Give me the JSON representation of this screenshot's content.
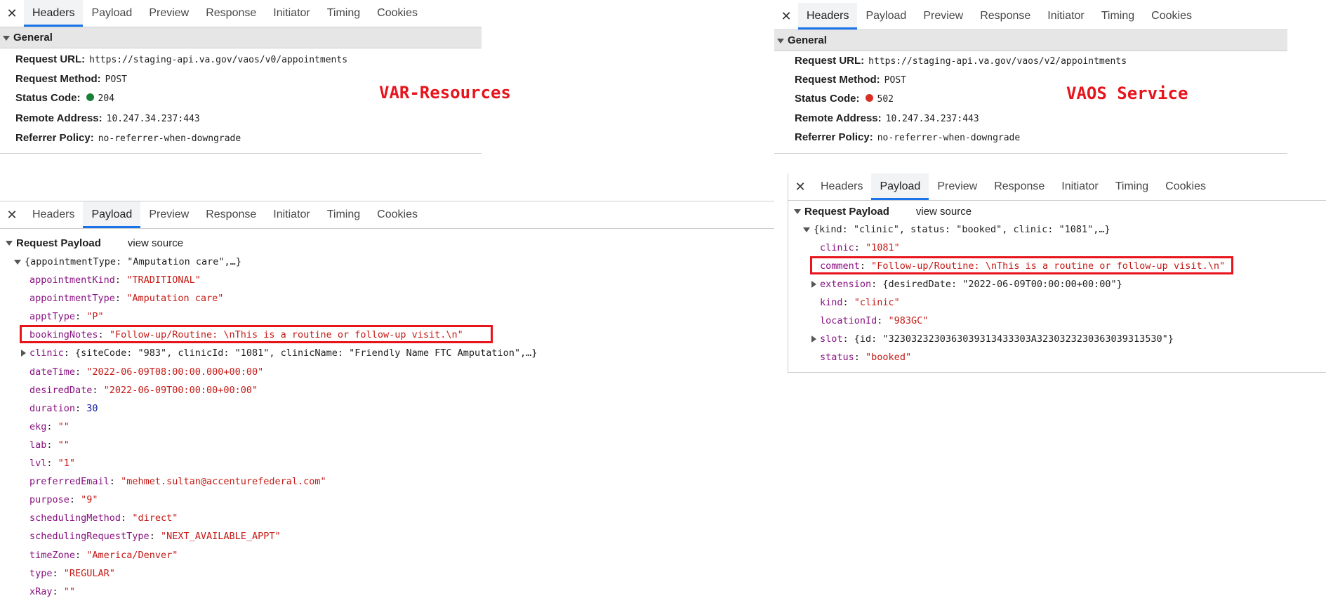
{
  "tabs": [
    "Headers",
    "Payload",
    "Preview",
    "Response",
    "Initiator",
    "Timing",
    "Cookies"
  ],
  "close_glyph": "✕",
  "left_headers": {
    "section": "General",
    "request_url_label": "Request URL:",
    "request_url": "https://staging-api.va.gov/vaos/v0/appointments",
    "request_method_label": "Request Method:",
    "request_method": "POST",
    "status_code_label": "Status Code:",
    "status_code": "204",
    "status_color": "#188038",
    "remote_address_label": "Remote Address:",
    "remote_address": "10.247.34.237:443",
    "referrer_policy_label": "Referrer Policy:",
    "referrer_policy": "no-referrer-when-downgrade",
    "annotation": "VAR-Resources"
  },
  "right_headers": {
    "section": "General",
    "request_url_label": "Request URL:",
    "request_url": "https://staging-api.va.gov/vaos/v2/appointments",
    "request_method_label": "Request Method:",
    "request_method": "POST",
    "status_code_label": "Status Code:",
    "status_code": "502",
    "status_color": "#d93025",
    "remote_address_label": "Remote Address:",
    "remote_address": "10.247.34.237:443",
    "referrer_policy_label": "Referrer Policy:",
    "referrer_policy": "no-referrer-when-downgrade",
    "annotation": "VAOS Service"
  },
  "left_payload": {
    "title": "Request Payload",
    "view_source": "view source",
    "summary": "{appointmentType: \"Amputation care\",…}",
    "fields": [
      {
        "key": "appointmentKind",
        "val": "\"TRADITIONAL\"",
        "type": "str"
      },
      {
        "key": "appointmentType",
        "val": "\"Amputation care\"",
        "type": "str"
      },
      {
        "key": "apptType",
        "val": "\"P\"",
        "type": "str"
      },
      {
        "key": "bookingNotes",
        "val": "\"Follow-up/Routine: \\nThis is a routine or follow-up visit.\\n\"",
        "type": "str",
        "highlight": true
      },
      {
        "key": "clinic",
        "val": "{siteCode: \"983\", clinicId: \"1081\", clinicName: \"Friendly Name FTC Amputation\",…}",
        "type": "obj",
        "expandable": true
      },
      {
        "key": "dateTime",
        "val": "\"2022-06-09T08:00:00.000+00:00\"",
        "type": "str"
      },
      {
        "key": "desiredDate",
        "val": "\"2022-06-09T00:00:00+00:00\"",
        "type": "str"
      },
      {
        "key": "duration",
        "val": "30",
        "type": "num"
      },
      {
        "key": "ekg",
        "val": "\"\"",
        "type": "str"
      },
      {
        "key": "lab",
        "val": "\"\"",
        "type": "str"
      },
      {
        "key": "lvl",
        "val": "\"1\"",
        "type": "str"
      },
      {
        "key": "preferredEmail",
        "val": "\"mehmet.sultan@accenturefederal.com\"",
        "type": "str"
      },
      {
        "key": "purpose",
        "val": "\"9\"",
        "type": "str"
      },
      {
        "key": "schedulingMethod",
        "val": "\"direct\"",
        "type": "str"
      },
      {
        "key": "schedulingRequestType",
        "val": "\"NEXT_AVAILABLE_APPT\"",
        "type": "str"
      },
      {
        "key": "timeZone",
        "val": "\"America/Denver\"",
        "type": "str"
      },
      {
        "key": "type",
        "val": "\"REGULAR\"",
        "type": "str"
      },
      {
        "key": "xRay",
        "val": "\"\"",
        "type": "str"
      }
    ]
  },
  "right_payload": {
    "title": "Request Payload",
    "view_source": "view source",
    "summary": "{kind: \"clinic\", status: \"booked\", clinic: \"1081\",…}",
    "fields": [
      {
        "key": "clinic",
        "val": "\"1081\"",
        "type": "str"
      },
      {
        "key": "comment",
        "val": "\"Follow-up/Routine: \\nThis is a routine or follow-up visit.\\n\"",
        "type": "str",
        "highlight": true
      },
      {
        "key": "extension",
        "val": "{desiredDate: \"2022-06-09T00:00:00+00:00\"}",
        "type": "obj",
        "expandable": true
      },
      {
        "key": "kind",
        "val": "\"clinic\"",
        "type": "str"
      },
      {
        "key": "locationId",
        "val": "\"983GC\"",
        "type": "str"
      },
      {
        "key": "slot",
        "val": "{id: \"3230323230363039313433303A3230323230363039313530\"}",
        "type": "obj",
        "expandable": true
      },
      {
        "key": "status",
        "val": "\"booked\"",
        "type": "str"
      }
    ]
  },
  "colors": {
    "highlight": "#e8141c",
    "accent": "#1a73e8",
    "key": "#881280",
    "string": "#c41a16"
  }
}
